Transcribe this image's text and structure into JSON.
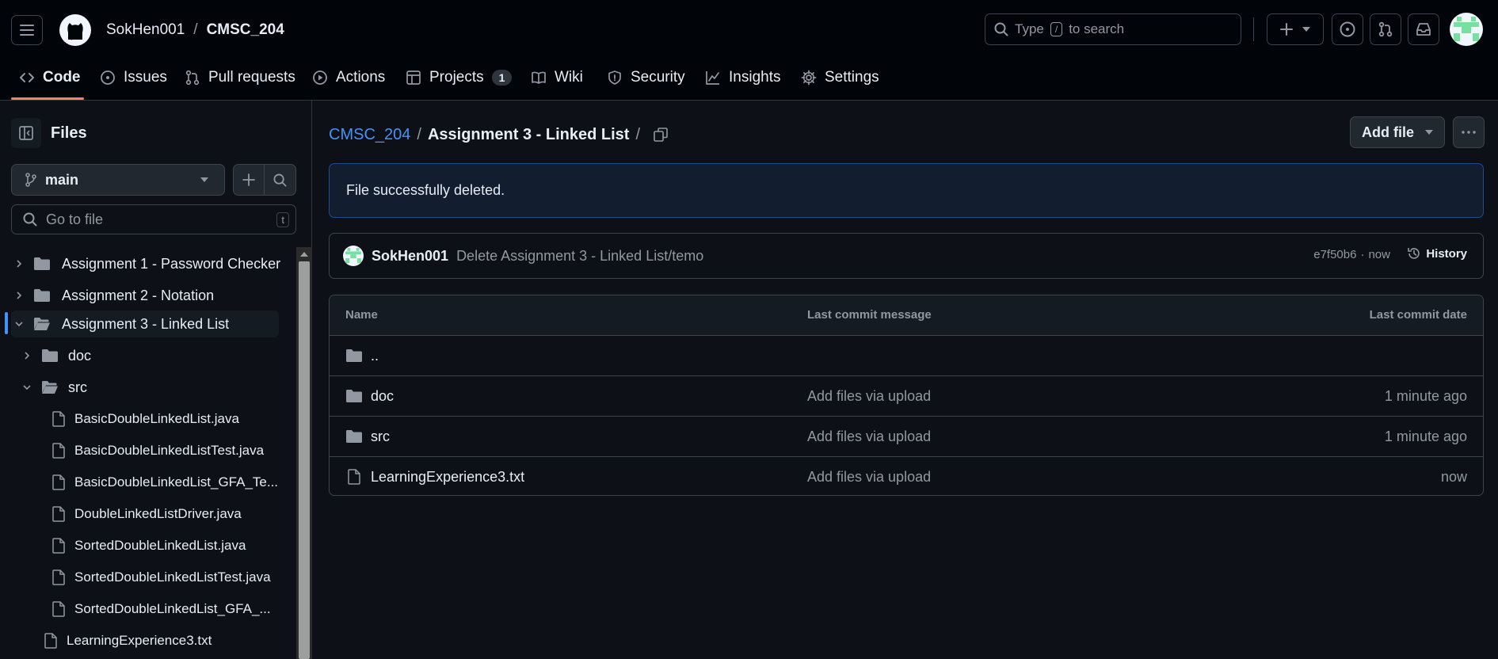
{
  "header": {
    "owner": "SokHen001",
    "separator": "/",
    "repo": "CMSC_204",
    "search_prefix": "Type",
    "search_key": "/",
    "search_suffix": "to search"
  },
  "tabs": [
    {
      "label": "Code",
      "icon": "code-icon",
      "active": true
    },
    {
      "label": "Issues",
      "icon": "issue-opened-icon"
    },
    {
      "label": "Pull requests",
      "icon": "git-pull-request-icon"
    },
    {
      "label": "Actions",
      "icon": "play-icon"
    },
    {
      "label": "Projects",
      "icon": "table-icon",
      "count": "1"
    },
    {
      "label": "Wiki",
      "icon": "book-icon"
    },
    {
      "label": "Security",
      "icon": "shield-icon"
    },
    {
      "label": "Insights",
      "icon": "graph-icon"
    },
    {
      "label": "Settings",
      "icon": "gear-icon"
    }
  ],
  "sidebar": {
    "title": "Files",
    "branch": "main",
    "goto_placeholder": "Go to file",
    "goto_shortcut": "t",
    "tree": [
      {
        "label": "Assignment 1 - Password Checker",
        "type": "folder",
        "expanded": false
      },
      {
        "label": "Assignment 2 - Notation",
        "type": "folder",
        "expanded": false
      },
      {
        "label": "Assignment 3 - Linked List",
        "type": "folder",
        "expanded": true,
        "selected": true
      },
      {
        "label": "doc",
        "type": "folder",
        "expanded": false
      },
      {
        "label": "src",
        "type": "folder",
        "expanded": true
      },
      {
        "label": "BasicDoubleLinkedList.java",
        "type": "file"
      },
      {
        "label": "BasicDoubleLinkedListTest.java",
        "type": "file"
      },
      {
        "label": "BasicDoubleLinkedList_GFA_Te...",
        "type": "file"
      },
      {
        "label": "DoubleLinkedListDriver.java",
        "type": "file"
      },
      {
        "label": "SortedDoubleLinkedList.java",
        "type": "file"
      },
      {
        "label": "SortedDoubleLinkedListTest.java",
        "type": "file"
      },
      {
        "label": "SortedDoubleLinkedList_GFA_...",
        "type": "file"
      },
      {
        "label": "LearningExperience3.txt",
        "type": "file"
      }
    ]
  },
  "main": {
    "breadcrumb_repo": "CMSC_204",
    "breadcrumb_sep": "/",
    "breadcrumb_folder": "Assignment 3 - Linked List",
    "breadcrumb_trailing": "/",
    "add_file_label": "Add file",
    "flash": "File successfully deleted.",
    "commit": {
      "author": "SokHen001",
      "message": "Delete Assignment 3 - Linked List/temo",
      "sha": "e7f50b6",
      "dot": "·",
      "time": "now",
      "history_label": "History"
    },
    "table": {
      "headers": {
        "name": "Name",
        "message": "Last commit message",
        "date": "Last commit date"
      },
      "rows": [
        {
          "name": "..",
          "type": "folder",
          "message": "",
          "date": ""
        },
        {
          "name": "doc",
          "type": "folder",
          "message": "Add files via upload",
          "date": "1 minute ago"
        },
        {
          "name": "src",
          "type": "folder",
          "message": "Add files via upload",
          "date": "1 minute ago"
        },
        {
          "name": "LearningExperience3.txt",
          "type": "file",
          "message": "Add files via upload",
          "date": "now"
        }
      ]
    }
  },
  "colors": {
    "accent": "#4493f8",
    "tab_underline": "#f78166",
    "flash_bg": "#121d2f",
    "flash_border": "#1f4d8c",
    "avatar_green": "#75e0a0"
  }
}
